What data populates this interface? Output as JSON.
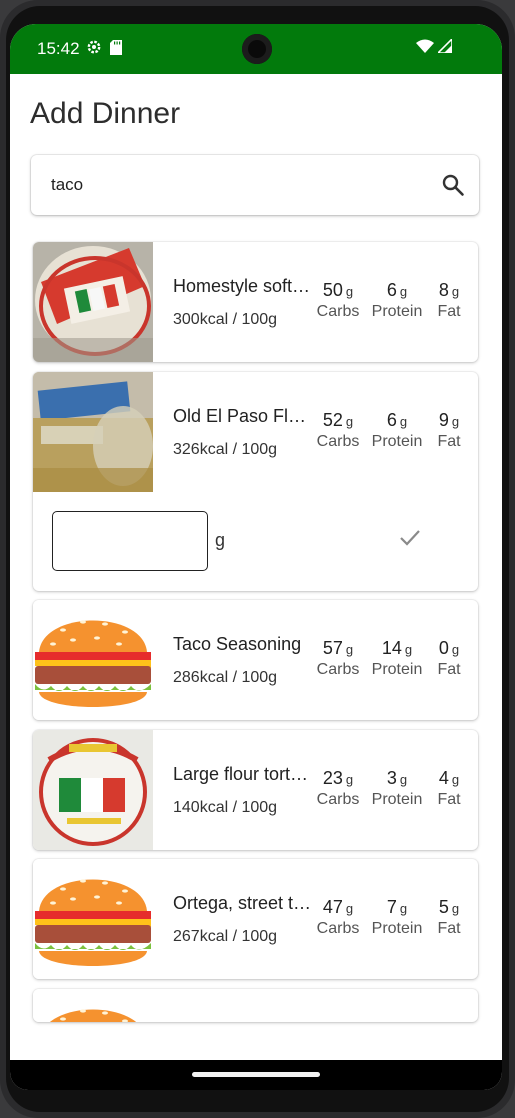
{
  "status_bar": {
    "time": "15:42",
    "color": "#027a0c",
    "icons_left": [
      "settings-icon",
      "sd-card-icon"
    ],
    "icons_right": [
      "wifi-icon",
      "signal-icon"
    ]
  },
  "page": {
    "title": "Add Dinner"
  },
  "search": {
    "value": "taco",
    "icon": "search-icon"
  },
  "macro_labels": {
    "carbs": "Carbs",
    "protein": "Protein",
    "fat": "Fat",
    "unit": "g"
  },
  "foods": [
    {
      "name": "Homestyle soft…",
      "kcal": "300kcal / 100g",
      "carbs": "50",
      "protein": "6",
      "fat": "8",
      "image": "tortilla-package"
    },
    {
      "name": "Old El Paso Flo…",
      "kcal": "326kcal / 100g",
      "carbs": "52",
      "protein": "6",
      "fat": "9",
      "image": "tortilla-bag",
      "expanded": true
    },
    {
      "name": "Taco Seasoning",
      "kcal": "286kcal / 100g",
      "carbs": "57",
      "protein": "14",
      "fat": "0",
      "image": "burger-placeholder"
    },
    {
      "name": "Large flour tort…",
      "kcal": "140kcal / 100g",
      "carbs": "23",
      "protein": "3",
      "fat": "4",
      "image": "soft-taco-package"
    },
    {
      "name": "Ortega, street t…",
      "kcal": "267kcal / 100g",
      "carbs": "47",
      "protein": "7",
      "fat": "5",
      "image": "burger-placeholder"
    }
  ],
  "amount": {
    "value": "",
    "unit": "g",
    "confirm_icon": "check-icon"
  }
}
